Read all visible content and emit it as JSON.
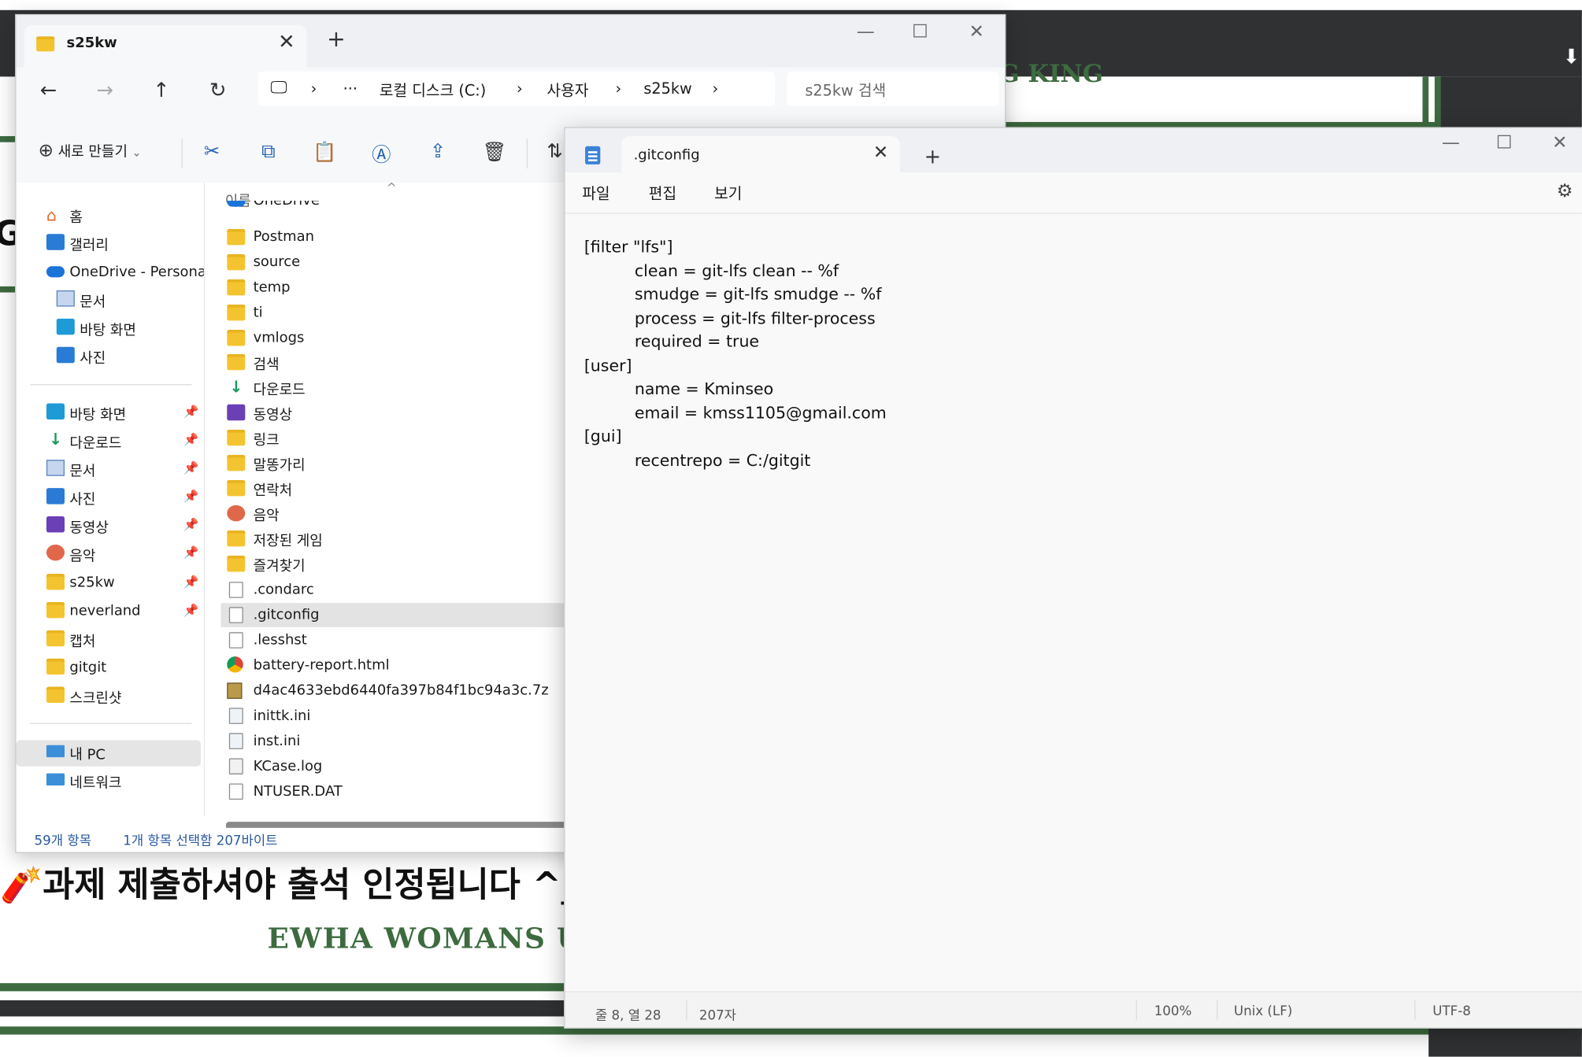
{
  "background_page": {
    "notice": "🧨과제 제출하셔야 출석 인정됩니다 ^_^",
    "university": "EWHA WOMANS UNI",
    "banner_text": "G KING",
    "brand_color": "#3d6b3f"
  },
  "explorer": {
    "tab_title": "s25kw",
    "breadcrumb": [
      "로컬 디스크 (C:)",
      "사용자",
      "s25kw"
    ],
    "breadcrumb_more": "···",
    "search_placeholder": "s25kw 검색",
    "toolbar": {
      "new_label": "새로 만들기"
    },
    "column_name": "이름",
    "sidebar": {
      "home": "홈",
      "gallery": "갤러리",
      "onedrive": "OneDrive - Personal",
      "onedrive_items": [
        "문서",
        "바탕 화면",
        "사진"
      ],
      "quick": [
        "바탕 화면",
        "다운로드",
        "문서",
        "사진",
        "동영상",
        "음악",
        "s25kw",
        "neverland",
        "캡처",
        "gitgit",
        "스크린샷"
      ],
      "this_pc": "내 PC",
      "network": "네트워크"
    },
    "files": [
      {
        "name": "OneDrive",
        "icon": "onedrive-icon"
      },
      {
        "name": "Postman",
        "icon": "folder-icon"
      },
      {
        "name": "source",
        "icon": "folder-icon"
      },
      {
        "name": "temp",
        "icon": "folder-icon"
      },
      {
        "name": "ti",
        "icon": "folder-icon"
      },
      {
        "name": "vmlogs",
        "icon": "folder-icon"
      },
      {
        "name": "검색",
        "icon": "folder-icon"
      },
      {
        "name": "다운로드",
        "icon": "download-icon"
      },
      {
        "name": "동영상",
        "icon": "video-icon"
      },
      {
        "name": "링크",
        "icon": "folder-icon"
      },
      {
        "name": "말똥가리",
        "icon": "folder-icon"
      },
      {
        "name": "연락처",
        "icon": "folder-icon"
      },
      {
        "name": "음악",
        "icon": "music-icon"
      },
      {
        "name": "저장된 게임",
        "icon": "folder-icon"
      },
      {
        "name": "즐겨찾기",
        "icon": "folder-icon"
      },
      {
        "name": ".condarc",
        "icon": "file-icon"
      },
      {
        "name": ".gitconfig",
        "icon": "file-icon",
        "selected": true
      },
      {
        "name": ".lesshst",
        "icon": "file-icon"
      },
      {
        "name": "battery-report.html",
        "icon": "chrome-icon"
      },
      {
        "name": "d4ac4633ebd6440fa397b84f1bc94a3c.7z",
        "icon": "archive-icon"
      },
      {
        "name": "inittk.ini",
        "icon": "ini-icon"
      },
      {
        "name": "inst.ini",
        "icon": "ini-icon"
      },
      {
        "name": "KCase.log",
        "icon": "log-icon"
      },
      {
        "name": "NTUSER.DAT",
        "icon": "file-icon"
      }
    ],
    "status": {
      "count": "59개 항목",
      "selection": "1개 항목 선택함 207바이트"
    }
  },
  "notepad": {
    "tab_title": ".gitconfig",
    "menu": [
      "파일",
      "편집",
      "보기"
    ],
    "lines": [
      {
        "text": "[filter \"lfs\"]",
        "indent": false
      },
      {
        "text": "clean = git-lfs clean -- %f",
        "indent": true
      },
      {
        "text": "smudge = git-lfs smudge -- %f",
        "indent": true
      },
      {
        "text": "process = git-lfs filter-process",
        "indent": true
      },
      {
        "text": "required = true",
        "indent": true
      },
      {
        "text": "[user]",
        "indent": false
      },
      {
        "text": "name = Kminseo",
        "indent": true
      },
      {
        "text": "email = kmss1105@gmail.com",
        "indent": true
      },
      {
        "text": "[gui]",
        "indent": false
      },
      {
        "text": "recentrepo = C:/gitgit",
        "indent": true
      }
    ],
    "status": {
      "position": "줄 8, 열 28",
      "chars": "207자",
      "zoom": "100%",
      "eol": "Unix (LF)",
      "encoding": "UTF-8"
    }
  }
}
